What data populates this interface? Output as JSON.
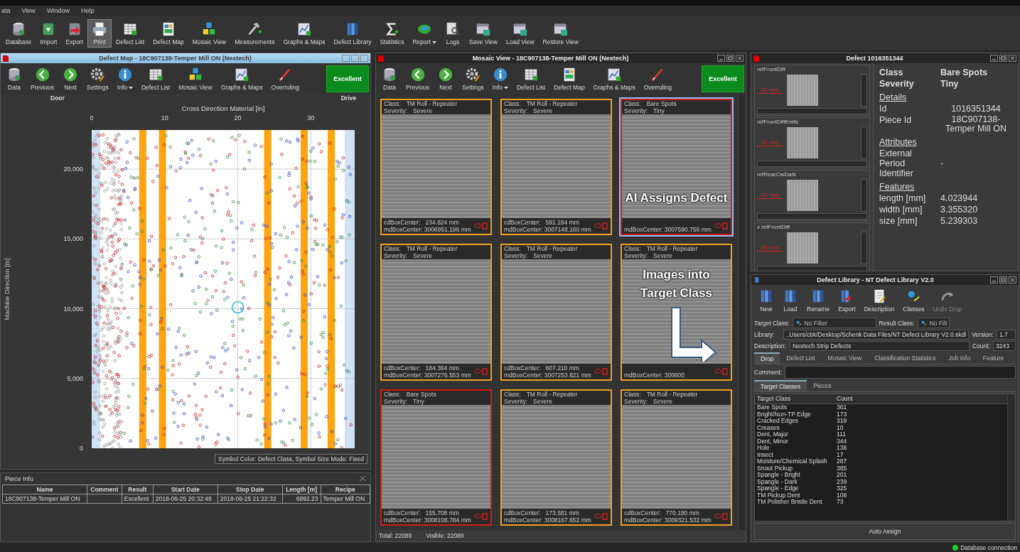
{
  "menu_bar": {
    "items": [
      "ata",
      "View",
      "Window",
      "Help"
    ]
  },
  "main_toolbar": {
    "items": [
      {
        "label": "Database",
        "selected": false,
        "has_menu": false
      },
      {
        "label": "Import",
        "selected": false,
        "has_menu": false
      },
      {
        "label": "Export",
        "selected": false,
        "has_menu": false
      },
      {
        "label": "Print",
        "selected": true,
        "has_menu": false
      },
      {
        "label": "Defect List",
        "selected": false,
        "has_menu": false
      },
      {
        "label": "Defect Map",
        "selected": false,
        "has_menu": false
      },
      {
        "label": "Mosaic View",
        "selected": false,
        "has_menu": false
      },
      {
        "label": "Measurements",
        "selected": false,
        "has_menu": false
      },
      {
        "label": "Graphs & Maps",
        "selected": false,
        "has_menu": false
      },
      {
        "label": "Defect Library",
        "selected": false,
        "has_menu": false
      },
      {
        "label": "Statistics",
        "selected": false,
        "has_menu": false
      },
      {
        "label": "Report",
        "selected": false,
        "has_menu": true
      },
      {
        "label": "Logs",
        "selected": false,
        "has_menu": false
      },
      {
        "label": "Save View",
        "selected": false,
        "has_menu": false
      },
      {
        "label": "Load View",
        "selected": false,
        "has_menu": false
      },
      {
        "label": "Restore View",
        "selected": false,
        "has_menu": false
      }
    ]
  },
  "defect_map_window": {
    "title": "Defect Map - 18C907138-Temper Mill ON (Nextech)",
    "active": true,
    "toolbar": [
      {
        "label": "Data",
        "has_menu": false
      },
      {
        "label": "Previous",
        "has_menu": false
      },
      {
        "label": "Next",
        "has_menu": false
      },
      {
        "label": "Settings",
        "has_menu": false
      },
      {
        "label": "Info",
        "has_menu": true
      },
      {
        "label": "Defect List",
        "has_menu": false
      },
      {
        "label": "Mosaic View",
        "has_menu": false
      },
      {
        "label": "Graphs & Maps",
        "has_menu": false
      },
      {
        "label": "Overruling",
        "has_menu": false
      }
    ],
    "result_button": "Excellent",
    "side_labels": [
      "Door",
      "Drive"
    ],
    "map": {
      "x_axis_label": "Cross Direction Material [in]",
      "x_ticks": [
        "0",
        "10",
        "20",
        "30"
      ],
      "y_axis_label": "Machine Direction [m]",
      "y_ticks": [
        "20,000",
        "15,000",
        "10,000",
        "5,000",
        "0"
      ]
    },
    "legend": "Symbol Color: Defect Class, Symbol Size Mode: Fixed"
  },
  "piece_info": {
    "title": "Piece Info",
    "columns": [
      "Name",
      "Comment",
      "Result",
      "Start Date",
      "Stop Date",
      "Length [m]",
      "Recipe"
    ],
    "rows": [
      [
        "18C907138-Temper Mill ON",
        "",
        "Excellent",
        "2018-06-25 20:32:48",
        "2018-06-25 21:22:32",
        "6892.23",
        "Temper Mill ON"
      ]
    ]
  },
  "mosaic_window": {
    "title": "Mosaic View - 18C907138-Temper Mill ON (Nextech)",
    "active": false,
    "toolbar": [
      {
        "label": "Data",
        "has_menu": false
      },
      {
        "label": "Previous",
        "has_menu": false
      },
      {
        "label": "Next",
        "has_menu": false
      },
      {
        "label": "Settings",
        "has_menu": false
      },
      {
        "label": "Info",
        "has_menu": true
      },
      {
        "label": "Defect List",
        "has_menu": false
      },
      {
        "label": "Defect Map",
        "has_menu": false
      },
      {
        "label": "Graphs & Maps",
        "has_menu": false
      },
      {
        "label": "Overruling",
        "has_menu": false
      }
    ],
    "result_button": "Excellent",
    "tiles": [
      {
        "class_label": "Class:",
        "class": "TM Roll - Repeater",
        "severity_label": "Severity:",
        "severity": "Severe",
        "cd": "cdBoxCenter:   234.824 mm",
        "md": "mdBoxCenter: 3006951.196 mm",
        "color": "#f0a020",
        "selected": false
      },
      {
        "class_label": "Class:",
        "class": "TM Roll - Repeater",
        "severity_label": "Severity:",
        "severity": "Severe",
        "cd": "cdBoxCenter:   591.194 mm",
        "md": "mdBoxCenter: 3007148.160 mm",
        "color": "#f0a020",
        "selected": false
      },
      {
        "class_label": "Class:",
        "class": "Bare Spots",
        "severity_label": "Severity:",
        "severity": "Tiny",
        "md": "mdBoxCenter: 3007590.756 mm",
        "color": "#d81818",
        "selected": true
      },
      {
        "class_label": "Class:",
        "class": "TM Roll - Repeater",
        "severity_label": "Severity:",
        "severity": "Severe",
        "cd": "cdBoxCenter:   184.394 mm",
        "md": "mdBoxCenter: 3007276.553 mm",
        "color": "#f0a020",
        "selected": false
      },
      {
        "class_label": "Class:",
        "class": "TM Roll - Repeater",
        "severity_label": "Severity:",
        "severity": "Severe",
        "cd": "cdBoxCenter:   607.210 mm",
        "md": "mdBoxCenter: 3007253.821 mm",
        "color": "#f0a020",
        "selected": false
      },
      {
        "class_label": "Class:",
        "class": "TM Roll - Repeater",
        "severity_label": "Severity:",
        "severity": "Severe",
        "md": "mdBoxCenter: 300800",
        "color": "#f0a020",
        "selected": false
      },
      {
        "class_label": "Class:",
        "class": "Bare Spots",
        "severity_label": "Severity:",
        "severity": "Tiny",
        "cd": "cdBoxCenter:   155.708 mm",
        "md": "mdBoxCenter: 3008108.784 mm",
        "color": "#d81818",
        "selected": false
      },
      {
        "class_label": "Class:",
        "class": "TM Roll - Repeater",
        "severity_label": "Severity:",
        "severity": "Severe",
        "cd": "cdBoxCenter:   173.581 mm",
        "md": "mdBoxCenter: 3008167.652 mm",
        "color": "#f0a020",
        "selected": false
      },
      {
        "class_label": "Class:",
        "class": "TM Roll - Repeater",
        "severity_label": "Severity:",
        "severity": "Severe",
        "cd": "cdBoxCenter:   770.190 mm",
        "md": "mdBoxCenter: 3009321.532 mm",
        "color": "#f0a020",
        "selected": false
      }
    ],
    "annotation": [
      "AI Assigns Defect",
      "Images into",
      "Target  Class"
    ],
    "total": "Total: 22089",
    "visible": "Visible: 22089"
  },
  "defect_window": {
    "title": "Defect 1016351344",
    "images": [
      {
        "label": "refFrontDiff",
        "scale": "20 mm"
      },
      {
        "label": "refFrontDiffKnife",
        "scale": "20 mm"
      },
      {
        "label": "refRearCwDark",
        "scale": "20 mm"
      },
      {
        "label": "x refFrontDiff",
        "scale": "20 mm"
      }
    ],
    "summary": [
      {
        "label": "Class",
        "value": "Bare Spots"
      },
      {
        "label": "Severity",
        "value": "Tiny"
      }
    ],
    "sections": [
      {
        "heading": "Details",
        "rows": [
          {
            "label": "Id",
            "value": "1016351344"
          },
          {
            "label": "Piece Id",
            "value": "18C907138-Temper Mill ON"
          }
        ]
      },
      {
        "heading": "Attributes",
        "rows": [
          {
            "label": "External Period Identifier",
            "value": "-"
          }
        ]
      },
      {
        "heading": "Features",
        "rows": [
          {
            "label": "length [mm]",
            "value": "4.023944"
          },
          {
            "label": "width [mm]",
            "value": "3.355320"
          },
          {
            "label": "size [mm]",
            "value": "5.239303"
          }
        ]
      }
    ]
  },
  "library_window": {
    "title": "Defect Library - NT Defect Library V2.0",
    "toolbar": [
      {
        "label": "New",
        "disabled": false
      },
      {
        "label": "Load",
        "disabled": false
      },
      {
        "label": "Rename",
        "disabled": false
      },
      {
        "label": "Export",
        "disabled": false
      },
      {
        "label": "Description",
        "disabled": false
      },
      {
        "label": "Classes",
        "disabled": false
      },
      {
        "label": "Undo Drop",
        "disabled": true
      }
    ],
    "target_class": {
      "label": "Target Class:",
      "value": "No Filter"
    },
    "result_class": {
      "label": "Result Class:",
      "value": "No Filt"
    },
    "library": {
      "label": "Library:",
      "value": "..Users/cbk/Desktop/Schenk Data Files/NT Defect Library V2.0.skdl"
    },
    "version": {
      "label": "Version:",
      "value": "1.7"
    },
    "description": {
      "label": "Description:",
      "value": "Nextech Strip Defects"
    },
    "count": {
      "label": "Count:",
      "value": "3243"
    },
    "tabs": [
      {
        "label": "Drop",
        "selected": true
      },
      {
        "label": "Defect List",
        "selected": false
      },
      {
        "label": "Mosaic View",
        "selected": false
      },
      {
        "label": "Classification Statistics",
        "selected": false
      },
      {
        "label": "Job Info",
        "selected": false
      },
      {
        "label": "Feature",
        "selected": false
      }
    ],
    "comment_label": "Comment:",
    "subtabs": [
      {
        "label": "Target Classes",
        "selected": true
      },
      {
        "label": "Pieces",
        "selected": false
      }
    ],
    "columns": [
      "Target Class",
      "Count"
    ],
    "rows": [
      [
        "Bare Spots",
        "361"
      ],
      [
        "Bright/Non-TP Edge",
        "173"
      ],
      [
        "Cracked Edges",
        "319"
      ],
      [
        "Creases",
        "10"
      ],
      [
        "Dent, Major",
        "111"
      ],
      [
        "Dent, Minor",
        "344"
      ],
      [
        "Hole",
        "138"
      ],
      [
        "Insect",
        "17"
      ],
      [
        "Moisture/Chemical Splash",
        "287"
      ],
      [
        "Snout Pickup",
        "385"
      ],
      [
        "Spangle - Bright",
        "201"
      ],
      [
        "Spangle - Dark",
        "239"
      ],
      [
        "Spangle - Edge",
        "325"
      ],
      [
        "TM Pickup Dent",
        "108"
      ],
      [
        "TM Polisher Bristle Dent",
        "73"
      ]
    ],
    "button": "Auto Assign"
  },
  "status_bar": {
    "connection": "Database connection",
    "connected": true
  }
}
